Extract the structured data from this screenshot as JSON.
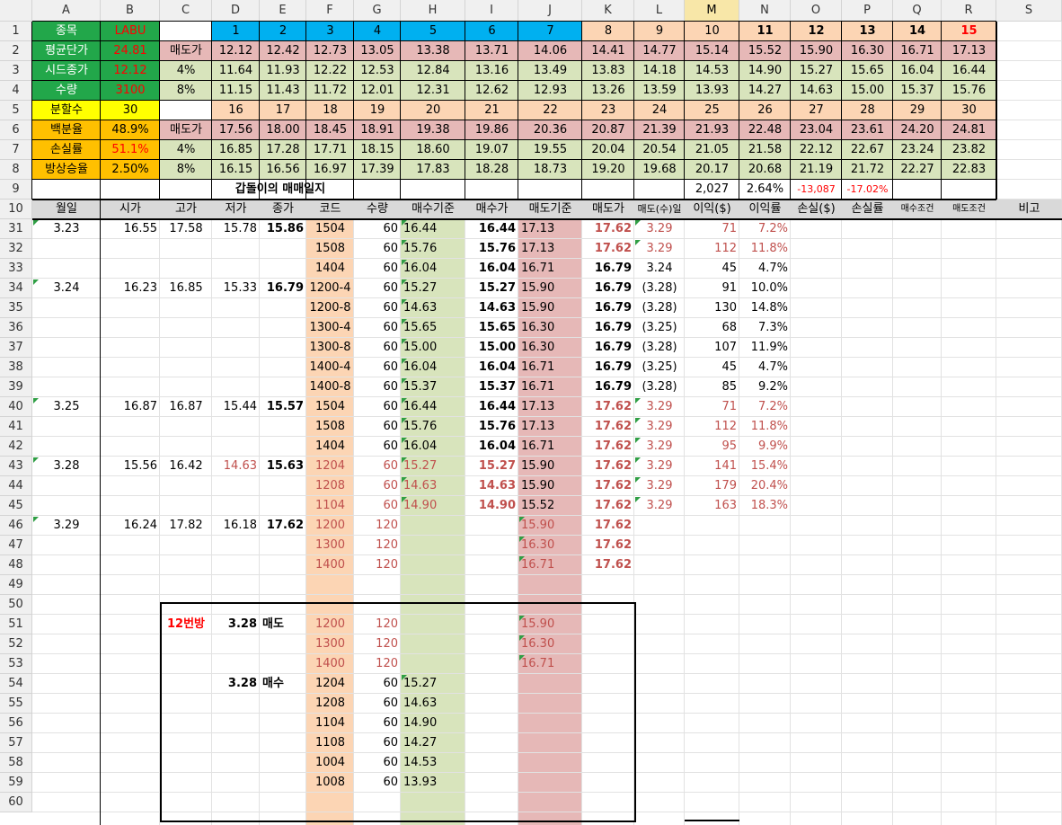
{
  "column_headers": [
    "A",
    "B",
    "C",
    "D",
    "E",
    "F",
    "G",
    "H",
    "I",
    "J",
    "K",
    "L",
    "M",
    "N",
    "O",
    "P",
    "Q",
    "R",
    "S"
  ],
  "selected_column": "M",
  "row_numbers": [
    "1",
    "2",
    "3",
    "4",
    "5",
    "6",
    "7",
    "8",
    "9",
    "10",
    "31",
    "32",
    "33",
    "34",
    "35",
    "36",
    "37",
    "38",
    "39",
    "40",
    "41",
    "42",
    "43",
    "44",
    "45",
    "46",
    "47",
    "48",
    "49",
    "50",
    "51",
    "52",
    "53",
    "54",
    "55",
    "56",
    "57",
    "58",
    "59",
    "60"
  ],
  "colors": {
    "green": "#22a74a",
    "orange": "#ffc000",
    "yellow": "#ffff00",
    "cyan": "#00b0f0",
    "peach": "#fcd5b4",
    "pink": "#e6b8b7",
    "light_green": "#d8e4bc",
    "header_gray": "#d9d9d9",
    "red_text": "#ff0000",
    "dark_red_text": "#c0504d"
  },
  "summary": {
    "r1": {
      "label": "종목",
      "value": "LABU"
    },
    "r2": {
      "label": "평균단가",
      "value": "24.81",
      "c": "매도가",
      "values": [
        "12.12",
        "12.42",
        "12.73",
        "13.05",
        "13.38",
        "13.71",
        "14.06",
        "14.41",
        "14.77",
        "15.14",
        "15.52",
        "15.90",
        "16.30",
        "16.71",
        "17.13"
      ]
    },
    "r3": {
      "label": "시드종가",
      "value": "12.12",
      "c": "4%",
      "values": [
        "11.64",
        "11.93",
        "12.22",
        "12.53",
        "12.84",
        "13.16",
        "13.49",
        "13.83",
        "14.18",
        "14.53",
        "14.90",
        "15.27",
        "15.65",
        "16.04",
        "16.44"
      ]
    },
    "r4": {
      "label": "수량",
      "value": "3100",
      "c": "8%",
      "values": [
        "11.15",
        "11.43",
        "11.72",
        "12.01",
        "12.31",
        "12.62",
        "12.93",
        "13.26",
        "13.59",
        "13.93",
        "14.27",
        "14.63",
        "15.00",
        "15.37",
        "15.76"
      ]
    },
    "r1_numbers": [
      "1",
      "2",
      "3",
      "4",
      "5",
      "6",
      "7",
      "8",
      "9",
      "10",
      "11",
      "12",
      "13",
      "14",
      "15"
    ],
    "r5": {
      "label": "분할수",
      "value": "30",
      "numbers": [
        "16",
        "17",
        "18",
        "19",
        "20",
        "21",
        "22",
        "23",
        "24",
        "25",
        "26",
        "27",
        "28",
        "29",
        "30"
      ]
    },
    "r6": {
      "label": "백분율",
      "value": "48.9%",
      "c": "매도가",
      "values": [
        "17.56",
        "18.00",
        "18.45",
        "18.91",
        "19.38",
        "19.86",
        "20.36",
        "20.87",
        "21.39",
        "21.93",
        "22.48",
        "23.04",
        "23.61",
        "24.20",
        "24.81"
      ]
    },
    "r7": {
      "label": "손실률",
      "value": "51.1%",
      "c": "4%",
      "values": [
        "16.85",
        "17.28",
        "17.71",
        "18.15",
        "18.60",
        "19.07",
        "19.55",
        "20.04",
        "20.54",
        "21.05",
        "21.58",
        "22.12",
        "22.67",
        "23.24",
        "23.82"
      ]
    },
    "r8": {
      "label": "방상승율",
      "value": "2.50%",
      "c": "8%",
      "values": [
        "16.15",
        "16.56",
        "16.97",
        "17.39",
        "17.83",
        "18.28",
        "18.73",
        "19.20",
        "19.68",
        "20.17",
        "20.68",
        "21.19",
        "21.72",
        "22.27",
        "22.83"
      ]
    },
    "r9": {
      "title": "갑돌이의 매매일지",
      "m": "2,027",
      "n": "2.64%",
      "o": "-13,087",
      "p": "-17.02%"
    }
  },
  "table_headers": [
    "월일",
    "시가",
    "고가",
    "저가",
    "종가",
    "코드",
    "수량",
    "매수기준",
    "매수가",
    "매도기준",
    "매도가",
    "매도(수)일",
    "이익($)",
    "이익률",
    "손실($)",
    "손실률",
    "매수조건",
    "매도조건",
    "비고"
  ],
  "rows": [
    {
      "n": "31",
      "A": "3.23",
      "B": "16.55",
      "C": "17.58",
      "D": "15.78",
      "E": "15.86",
      "F": "1504",
      "G": "60",
      "H": "16.44",
      "I": "16.44",
      "J": "17.13",
      "K": "17.62",
      "L": "3.29",
      "M": "71",
      "N": "7.2%",
      "red": "LMN"
    },
    {
      "n": "32",
      "F": "1508",
      "G": "60",
      "H": "15.76",
      "I": "15.76",
      "J": "17.13",
      "K": "17.62",
      "L": "3.29",
      "M": "112",
      "N": "11.8%",
      "red": "LMN"
    },
    {
      "n": "33",
      "F": "1404",
      "G": "60",
      "H": "16.04",
      "I": "16.04",
      "J": "16.71",
      "K": "16.79",
      "L": "3.24",
      "M": "45",
      "N": "4.7%",
      "red": ""
    },
    {
      "n": "34",
      "A": "3.24",
      "B": "16.23",
      "C": "16.85",
      "D": "15.33",
      "E": "16.79",
      "F": "1200-4",
      "G": "60",
      "H": "15.27",
      "I": "15.27",
      "J": "15.90",
      "K": "16.79",
      "L": "(3.28)",
      "M": "91",
      "N": "10.0%",
      "red": ""
    },
    {
      "n": "35",
      "F": "1200-8",
      "G": "60",
      "H": "14.63",
      "I": "14.63",
      "J": "15.90",
      "K": "16.79",
      "L": "(3.28)",
      "M": "130",
      "N": "14.8%",
      "red": ""
    },
    {
      "n": "36",
      "F": "1300-4",
      "G": "60",
      "H": "15.65",
      "I": "15.65",
      "J": "16.30",
      "K": "16.79",
      "L": "(3.25)",
      "M": "68",
      "N": "7.3%",
      "red": ""
    },
    {
      "n": "37",
      "F": "1300-8",
      "G": "60",
      "H": "15.00",
      "I": "15.00",
      "J": "16.30",
      "K": "16.79",
      "L": "(3.28)",
      "M": "107",
      "N": "11.9%",
      "red": ""
    },
    {
      "n": "38",
      "F": "1400-4",
      "G": "60",
      "H": "16.04",
      "I": "16.04",
      "J": "16.71",
      "K": "16.79",
      "L": "(3.25)",
      "M": "45",
      "N": "4.7%",
      "red": ""
    },
    {
      "n": "39",
      "F": "1400-8",
      "G": "60",
      "H": "15.37",
      "I": "15.37",
      "J": "16.71",
      "K": "16.79",
      "L": "(3.28)",
      "M": "85",
      "N": "9.2%",
      "red": ""
    },
    {
      "n": "40",
      "A": "3.25",
      "B": "16.87",
      "C": "16.87",
      "D": "15.44",
      "E": "15.57",
      "F": "1504",
      "G": "60",
      "H": "16.44",
      "I": "16.44",
      "J": "17.13",
      "K": "17.62",
      "L": "3.29",
      "M": "71",
      "N": "7.2%",
      "red": "LMN"
    },
    {
      "n": "41",
      "F": "1508",
      "G": "60",
      "H": "15.76",
      "I": "15.76",
      "J": "17.13",
      "K": "17.62",
      "L": "3.29",
      "M": "112",
      "N": "11.8%",
      "red": "LMN"
    },
    {
      "n": "42",
      "F": "1404",
      "G": "60",
      "H": "16.04",
      "I": "16.04",
      "J": "16.71",
      "K": "17.62",
      "L": "3.29",
      "M": "95",
      "N": "9.9%",
      "red": "LMN"
    },
    {
      "n": "43",
      "A": "3.28",
      "B": "15.56",
      "C": "16.42",
      "D": "14.63",
      "E": "15.63",
      "F": "1204",
      "G": "60",
      "H": "15.27",
      "I": "15.27",
      "J": "15.90",
      "K": "17.62",
      "L": "3.29",
      "M": "141",
      "N": "15.4%",
      "red": "DFGHILMN"
    },
    {
      "n": "44",
      "F": "1208",
      "G": "60",
      "H": "14.63",
      "I": "14.63",
      "J": "15.90",
      "K": "17.62",
      "L": "3.29",
      "M": "179",
      "N": "20.4%",
      "red": "FGHILMN"
    },
    {
      "n": "45",
      "F": "1104",
      "G": "60",
      "H": "14.90",
      "I": "14.90",
      "J": "15.52",
      "K": "17.62",
      "L": "3.29",
      "M": "163",
      "N": "18.3%",
      "red": "FGHILMN"
    },
    {
      "n": "46",
      "A": "3.29",
      "B": "16.24",
      "C": "17.82",
      "D": "16.18",
      "E": "17.62",
      "F": "1200",
      "G": "120",
      "J": "15.90",
      "K": "17.62",
      "red": "FGJ"
    },
    {
      "n": "47",
      "F": "1300",
      "G": "120",
      "J": "16.30",
      "K": "17.62",
      "red": "FGJ"
    },
    {
      "n": "48",
      "F": "1400",
      "G": "120",
      "J": "16.71",
      "K": "17.62",
      "red": "FGJ"
    },
    {
      "n": "49"
    },
    {
      "n": "50"
    },
    {
      "n": "51",
      "C": "12번방",
      "D": "3.28",
      "E": "매도",
      "F": "1200",
      "G": "120",
      "J": "15.90",
      "red": "FGJ"
    },
    {
      "n": "52",
      "F": "1300",
      "G": "120",
      "J": "16.30",
      "red": "FGJ"
    },
    {
      "n": "53",
      "F": "1400",
      "G": "120",
      "J": "16.71",
      "red": "FGJ"
    },
    {
      "n": "54",
      "D": "3.28",
      "E": "매수",
      "F": "1204",
      "G": "60",
      "H": "15.27",
      "red": ""
    },
    {
      "n": "55",
      "F": "1208",
      "G": "60",
      "H": "14.63",
      "red": ""
    },
    {
      "n": "56",
      "F": "1104",
      "G": "60",
      "H": "14.90",
      "red": ""
    },
    {
      "n": "57",
      "F": "1108",
      "G": "60",
      "H": "14.27",
      "red": ""
    },
    {
      "n": "58",
      "F": "1004",
      "G": "60",
      "H": "14.53",
      "red": ""
    },
    {
      "n": "59",
      "F": "1008",
      "G": "60",
      "H": "13.93",
      "red": ""
    },
    {
      "n": "60"
    }
  ]
}
